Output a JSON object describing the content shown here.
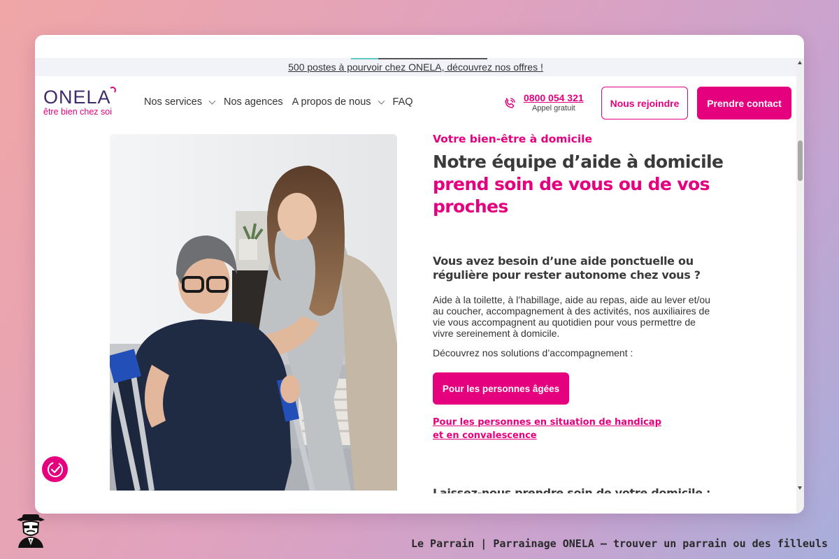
{
  "announcement": {
    "text": "500 postes à pourvoir chez ONELA, découvrez nos offres !",
    "progress": 0.2
  },
  "header": {
    "logo": {
      "name": "ONELA",
      "tagline": "être bien chez soi"
    },
    "nav": [
      {
        "label": "Nos services",
        "has_dropdown": true
      },
      {
        "label": "Nos agences",
        "has_dropdown": false
      },
      {
        "label": "A propos de nous",
        "has_dropdown": true
      },
      {
        "label": "FAQ",
        "has_dropdown": false
      }
    ],
    "phone": {
      "icon": "phone-icon",
      "number": "0800 054 321",
      "note": "Appel gratuit"
    },
    "join_label": "Nous rejoindre",
    "contact_label": "Prendre contact"
  },
  "hero": {
    "eyebrow": "Votre bien-être à domicile",
    "headline_dark": "Notre équipe d’aide à domicile",
    "headline_pink": "prend soin de vous ou de vos proches",
    "question": "Vous avez besoin d’une aide ponctuelle ou régulière pour rester autonome chez vous ?",
    "body": "Aide à la toilette, à l’habillage, aide au repas, aide au lever et/ou au coucher, accompagnement à des activités, nos auxiliaires de vie vous accompagnent au quotidien pour vous permettre de vivre sereinement à domicile.",
    "solutions_intro": "Découvrez nos solutions d’accompagnement :",
    "seniors_button": "Pour les personnes âgées",
    "handicap_link": "Pour les personnes en situation de handicap et en convalescence",
    "next_heading": "Laissez-nous prendre soin de votre domicile :"
  },
  "widget": {
    "icon": "badge-check-icon"
  },
  "caption": {
    "text": "Le Parrain | Parrainage ONELA — trouver un parrain ou des filleuls",
    "icon": "mafia-boss-icon"
  },
  "colors": {
    "brand_pink": "#e5007e",
    "brand_purple": "#3f2b6a",
    "text_dark": "#3a3a3a"
  }
}
